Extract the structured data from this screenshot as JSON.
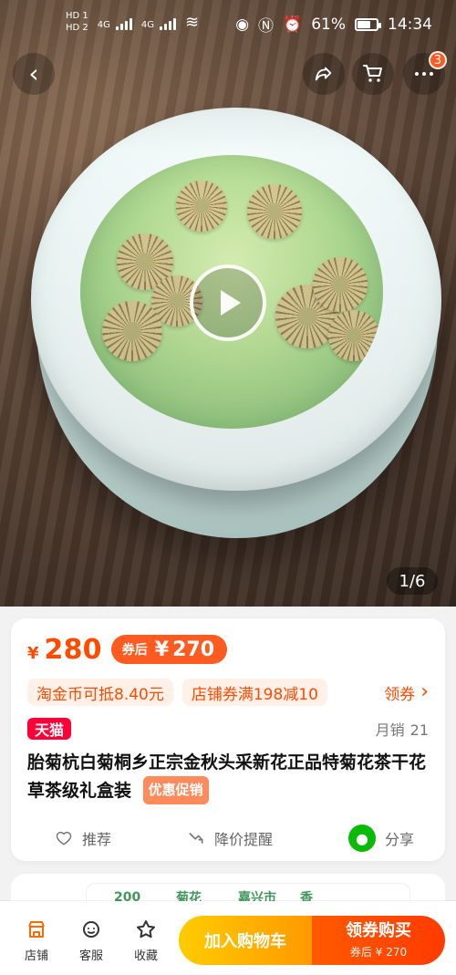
{
  "status_bar": {
    "left_labels": [
      "HD 1",
      "HD 2",
      "4G",
      "4G"
    ],
    "battery_percent": "61%",
    "time": "14:34"
  },
  "top_actions": {
    "cart_badge_count": "3"
  },
  "media": {
    "counter": "1/6"
  },
  "product": {
    "price_currency": "¥",
    "price_value": "280",
    "after_coupon_label": "券后",
    "after_coupon_currency": "¥",
    "after_coupon_value": "270",
    "promos": [
      "淘金币可抵8.40元",
      "店铺券满198减10"
    ],
    "get_coupon_label": "领券",
    "tmall_label": "天猫",
    "monthly_sales_label": "月销",
    "monthly_sales_value": "21",
    "title": "胎菊杭白菊桐乡正宗金秋头采新花正品特菊花茶干花草茶级礼盒装",
    "title_tag": "优惠促销",
    "actions": {
      "recommend": "推荐",
      "price_alert": "降价提醒",
      "share": "分享"
    }
  },
  "bottom_bar": {
    "shop": "店铺",
    "service": "客服",
    "favorite": "收藏",
    "add_to_cart": "加入购物车",
    "buy_with_coupon": "领券购买",
    "buy_sub_prefix": "券后",
    "buy_sub_currency": "¥",
    "buy_sub_value": "270"
  },
  "next_section_peek": [
    "200",
    "菊花",
    "嘉兴市",
    "香"
  ]
}
